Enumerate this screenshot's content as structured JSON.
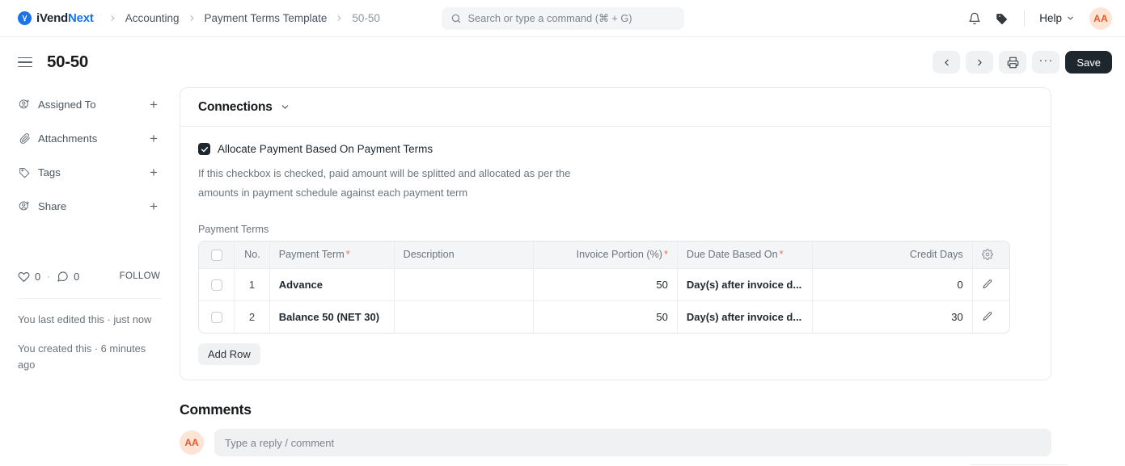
{
  "navbar": {
    "brand": {
      "part1": "iVend",
      "part2": "Next",
      "mark": "logo-icon"
    },
    "breadcrumbs": [
      {
        "label": "Accounting",
        "current": false
      },
      {
        "label": "Payment Terms Template",
        "current": false
      },
      {
        "label": "50-50",
        "current": true
      }
    ],
    "search": {
      "placeholder": "Search or type a command (⌘ + G)",
      "value": "",
      "icon": "search-icon"
    },
    "notification_icon": "bell-icon",
    "tag_icon": "tag-icon",
    "help_label": "Help",
    "avatar_initials": "AA"
  },
  "pagehead": {
    "title": "50-50",
    "menu_icon": "hamburger-icon",
    "prev_label": "‹",
    "next_label": "›",
    "print_icon": "printer-icon",
    "more_label": "···",
    "save_label": "Save"
  },
  "sidebar": {
    "items": [
      {
        "label": "Assigned To",
        "icon": "user-plus-icon",
        "add": "+"
      },
      {
        "label": "Attachments",
        "icon": "paperclip-icon",
        "add": "+"
      },
      {
        "label": "Tags",
        "icon": "tag-icon",
        "add": "+"
      },
      {
        "label": "Share",
        "icon": "user-plus-icon",
        "add": "+"
      }
    ],
    "social": {
      "like_icon": "heart-icon",
      "like_count": "0",
      "separator": "·",
      "comment_icon": "comment-icon",
      "comment_count": "0",
      "follow_label": "FOLLOW"
    },
    "notes": [
      "You last edited this · just now",
      "You created this · 6 minutes ago"
    ]
  },
  "main": {
    "connections": {
      "title": "Connections",
      "chevron": "chevron-down-icon"
    },
    "allocate": {
      "checked": true,
      "label": "Allocate Payment Based On Payment Terms",
      "help": "If this checkbox is checked, paid amount will be splitted and allocated as per the amounts in payment schedule against each payment term"
    },
    "payment_terms": {
      "label": "Payment Terms",
      "columns": [
        {
          "label": "",
          "key": "check",
          "required": false,
          "align": "center"
        },
        {
          "label": "No.",
          "key": "no",
          "required": false,
          "align": "right"
        },
        {
          "label": "Payment Term",
          "key": "term",
          "required": true,
          "align": "left"
        },
        {
          "label": "Description",
          "key": "desc",
          "required": false,
          "align": "left"
        },
        {
          "label": "Invoice Portion (%)",
          "key": "invoice",
          "required": true,
          "align": "right"
        },
        {
          "label": "Due Date Based On",
          "key": "due",
          "required": true,
          "align": "left"
        },
        {
          "label": "Credit Days",
          "key": "credit",
          "required": false,
          "align": "right"
        },
        {
          "label": "",
          "key": "gear",
          "required": false,
          "align": "center"
        }
      ],
      "rows": [
        {
          "no": "1",
          "term": "Advance",
          "desc": "",
          "invoice": "50",
          "due": "Day(s) after invoice d...",
          "credit": "0"
        },
        {
          "no": "2",
          "term": "Balance 50 (NET 30)",
          "desc": "",
          "invoice": "50",
          "due": "Day(s) after invoice d...",
          "credit": "30"
        }
      ],
      "gear_icon": "gear-icon",
      "edit_icon": "pencil-icon",
      "add_row_label": "Add Row"
    },
    "comments": {
      "title": "Comments",
      "avatar_initials": "AA",
      "placeholder": "Type a reply / comment"
    }
  },
  "colors": {
    "brand_blue": "#1a73e8",
    "accent_orange": "#e8572b",
    "required_red": "#f06b5d",
    "dark": "#1f272e"
  }
}
